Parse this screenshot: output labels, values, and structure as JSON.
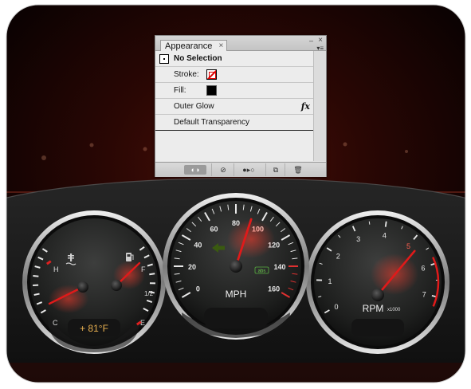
{
  "panel": {
    "tab_label": "Appearance",
    "tab_close": "×",
    "minimize": "‒",
    "close": "×",
    "menu": "▾≡",
    "rows": {
      "selection": "No Selection",
      "stroke": "Stroke:",
      "fill": "Fill:",
      "outer_glow": "Outer Glow",
      "fx": "fx",
      "transparency": "Default Transparency"
    },
    "bottom_icons": [
      "visibility-toggle-icon",
      "clear-appearance-icon",
      "reduce-to-basic-icon",
      "duplicate-item-icon",
      "delete-item-icon"
    ]
  },
  "dashboard": {
    "left_gauge": {
      "hot": "H",
      "cold": "C",
      "full": "F",
      "half": "1/2",
      "empty": "E",
      "temperature": "+ 81°F"
    },
    "center_gauge": {
      "unit": "MPH",
      "ticks": [
        "0",
        "20",
        "40",
        "60",
        "80",
        "100",
        "120",
        "140",
        "160"
      ],
      "abs": "abs",
      "value": 92
    },
    "right_gauge": {
      "unit": "RPM",
      "multiplier": "x1000",
      "ticks": [
        "0",
        "1",
        "2",
        "3",
        "4",
        "5",
        "6",
        "7"
      ],
      "value": 5
    }
  },
  "colors": {
    "needle": "#e01a1a",
    "warning": "#e02020",
    "accent_glow": "#c0281a"
  }
}
